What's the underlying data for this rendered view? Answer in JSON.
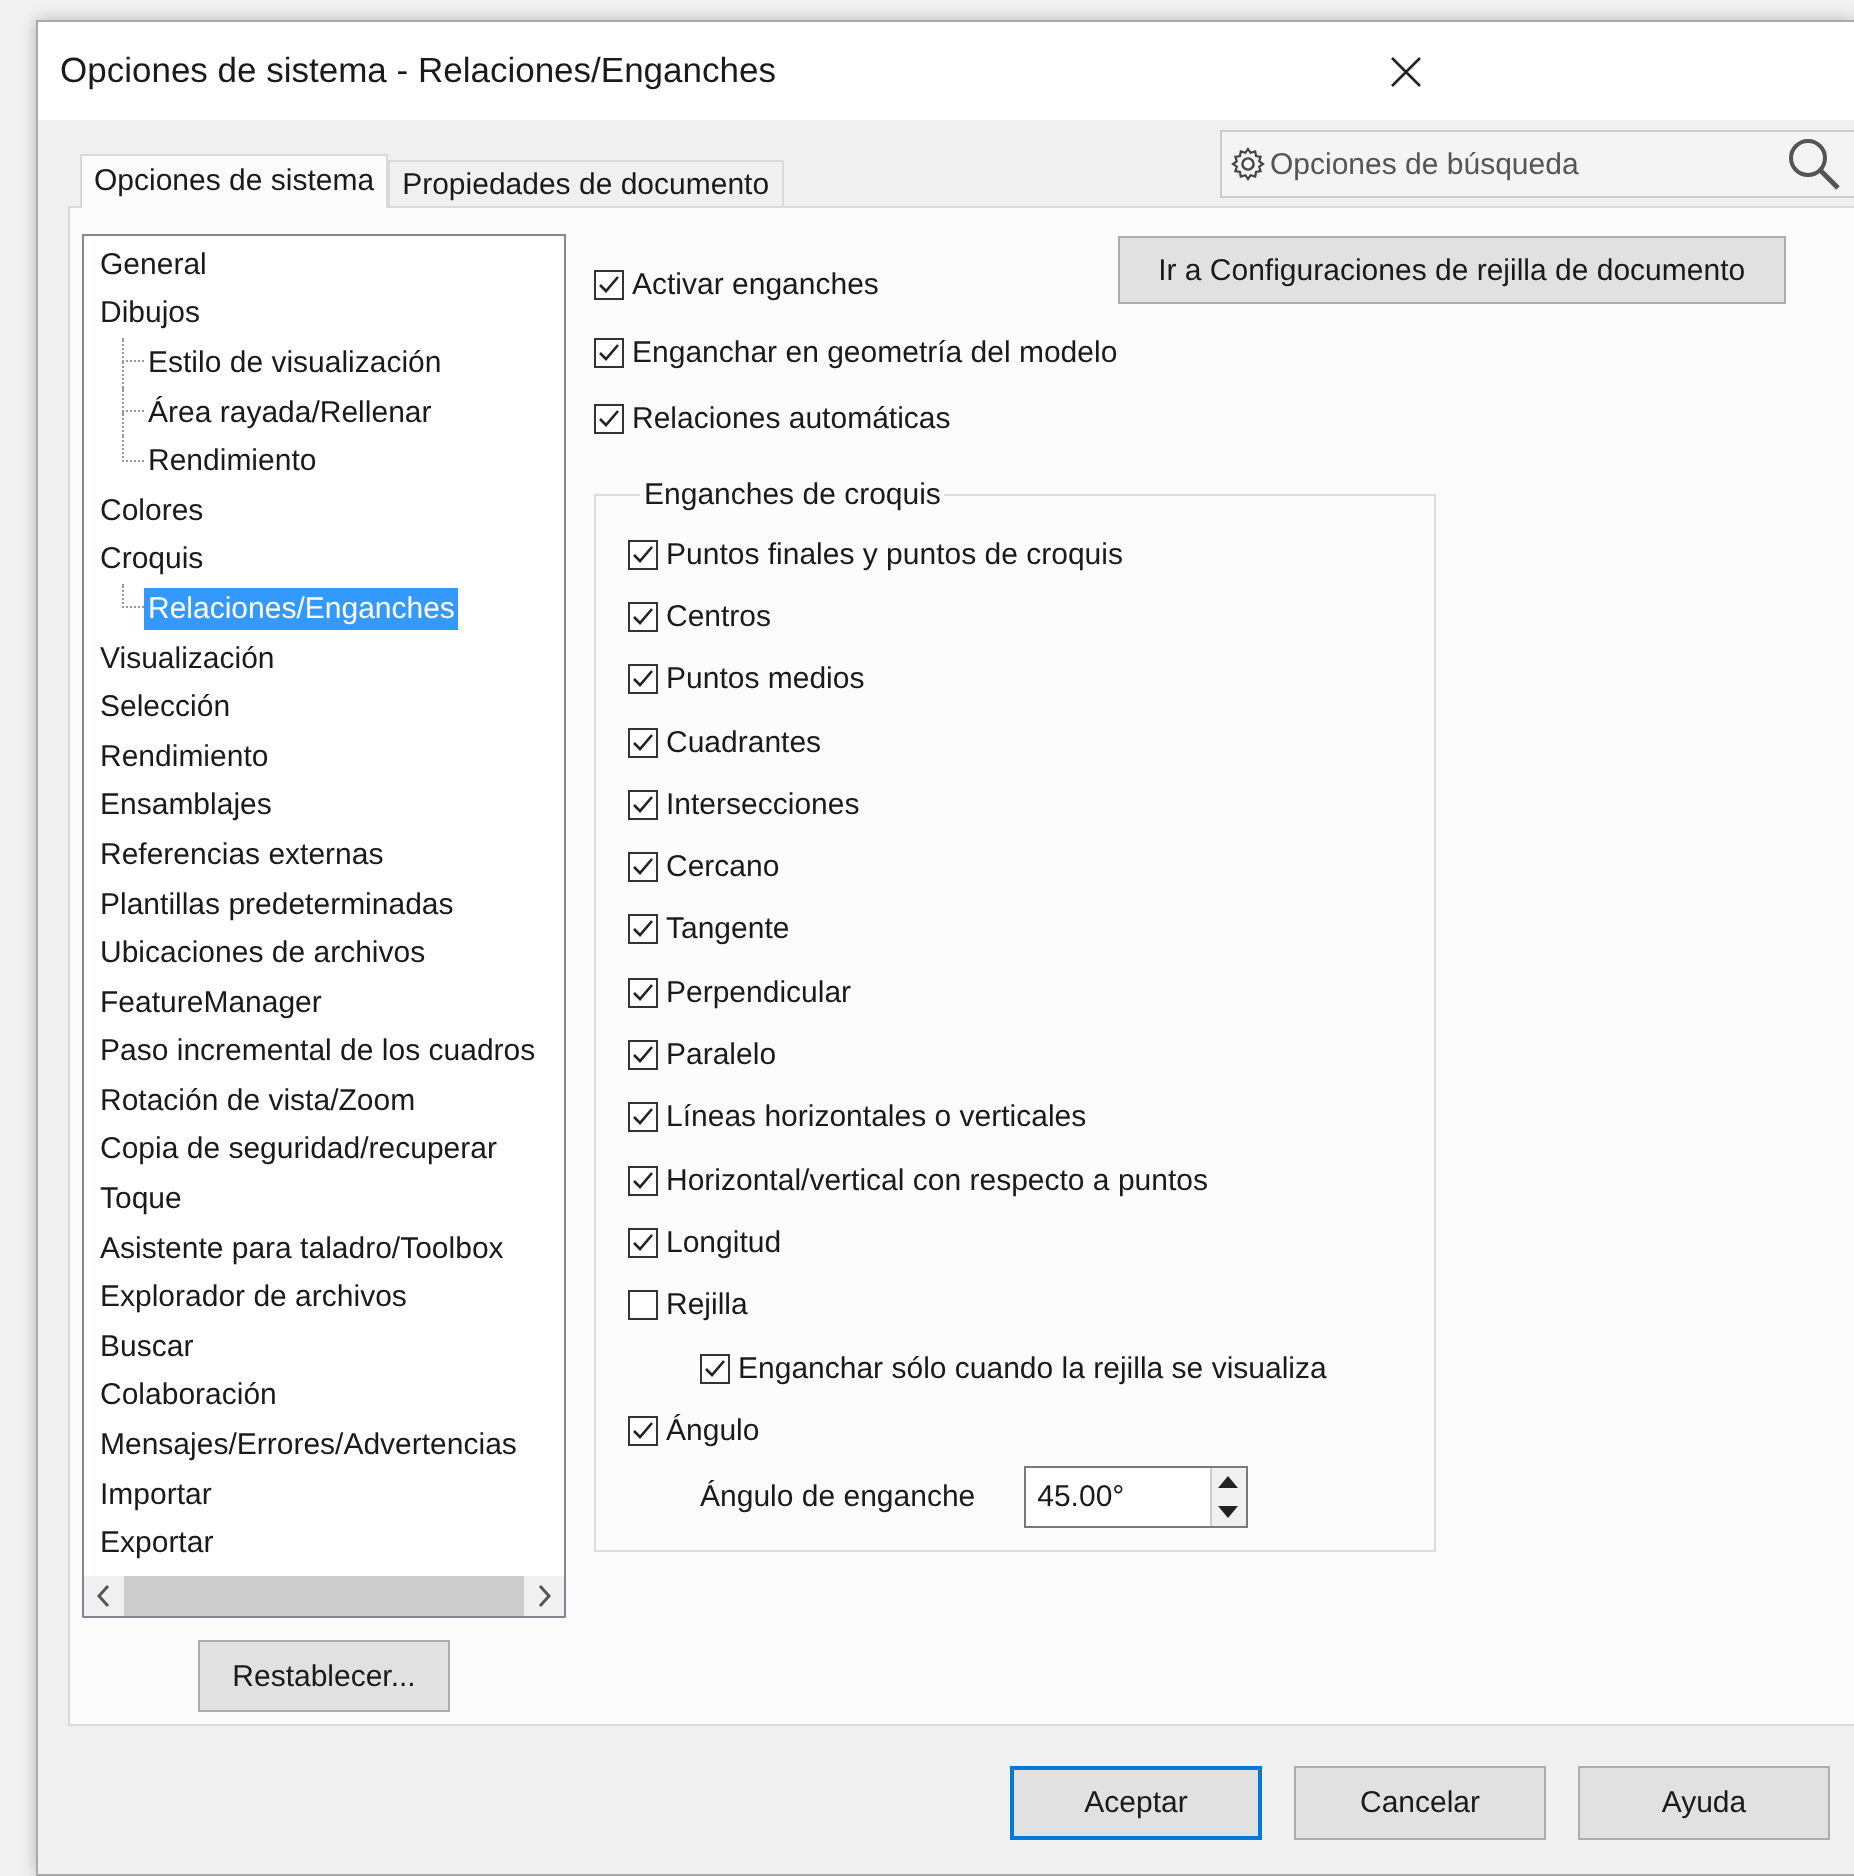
{
  "window": {
    "title": "Opciones de sistema - Relaciones/Enganches"
  },
  "tabs": [
    {
      "label": "Opciones de sistema",
      "selected": true
    },
    {
      "label": "Propiedades de documento",
      "selected": false
    }
  ],
  "search": {
    "placeholder": "Opciones de búsqueda"
  },
  "tree": [
    {
      "label": "General",
      "selected": false
    },
    {
      "label": "Dibujos",
      "selected": false,
      "children": [
        {
          "label": "Estilo de visualización",
          "selected": false
        },
        {
          "label": "Área rayada/Rellenar",
          "selected": false
        },
        {
          "label": "Rendimiento",
          "selected": false
        }
      ]
    },
    {
      "label": "Colores",
      "selected": false
    },
    {
      "label": "Croquis",
      "selected": false,
      "children": [
        {
          "label": "Relaciones/Enganches",
          "selected": true
        }
      ]
    },
    {
      "label": "Visualización",
      "selected": false
    },
    {
      "label": "Selección",
      "selected": false
    },
    {
      "label": "Rendimiento",
      "selected": false
    },
    {
      "label": "Ensamblajes",
      "selected": false
    },
    {
      "label": "Referencias externas",
      "selected": false
    },
    {
      "label": "Plantillas predeterminadas",
      "selected": false
    },
    {
      "label": "Ubicaciones de archivos",
      "selected": false
    },
    {
      "label": "FeatureManager",
      "selected": false
    },
    {
      "label": "Paso incremental de los cuadros",
      "selected": false
    },
    {
      "label": "Rotación de vista/Zoom",
      "selected": false
    },
    {
      "label": "Copia de seguridad/recuperar",
      "selected": false
    },
    {
      "label": "Toque",
      "selected": false
    },
    {
      "label": "Asistente para taladro/Toolbox",
      "selected": false
    },
    {
      "label": "Explorador de archivos",
      "selected": false
    },
    {
      "label": "Buscar",
      "selected": false
    },
    {
      "label": "Colaboración",
      "selected": false
    },
    {
      "label": "Mensajes/Errores/Advertencias",
      "selected": false
    },
    {
      "label": "Importar",
      "selected": false
    },
    {
      "label": "Exportar",
      "selected": false
    }
  ],
  "reset_button": "Restablecer...",
  "grid_button": "Ir a Configuraciones de rejilla de documento",
  "options": [
    {
      "label": "Activar enganches",
      "checked": true
    },
    {
      "label": "Enganchar en geometría del modelo",
      "checked": true
    },
    {
      "label": "Relaciones automáticas",
      "checked": true
    }
  ],
  "group": {
    "title": "Enganches de croquis",
    "options": [
      {
        "label": "Puntos finales y puntos de croquis",
        "checked": true
      },
      {
        "label": "Centros",
        "checked": true
      },
      {
        "label": "Puntos medios",
        "checked": true
      },
      {
        "label": "Cuadrantes",
        "checked": true
      },
      {
        "label": "Intersecciones",
        "checked": true
      },
      {
        "label": "Cercano",
        "checked": true
      },
      {
        "label": "Tangente",
        "checked": true
      },
      {
        "label": "Perpendicular",
        "checked": true
      },
      {
        "label": "Paralelo",
        "checked": true
      },
      {
        "label": "Líneas horizontales o verticales",
        "checked": true
      },
      {
        "label": "Horizontal/vertical con respecto a puntos",
        "checked": true
      },
      {
        "label": "Longitud",
        "checked": true
      },
      {
        "label": "Rejilla",
        "checked": false,
        "children": [
          {
            "label": "Enganchar sólo cuando la rejilla se visualiza",
            "checked": true
          }
        ]
      },
      {
        "label": "Ángulo",
        "checked": true
      }
    ],
    "angle_field": {
      "label": "Ángulo de enganche",
      "value": "45.00°"
    }
  },
  "buttons": [
    {
      "label": "Aceptar",
      "default": true
    },
    {
      "label": "Cancelar",
      "default": false
    },
    {
      "label": "Ayuda",
      "default": false
    }
  ]
}
